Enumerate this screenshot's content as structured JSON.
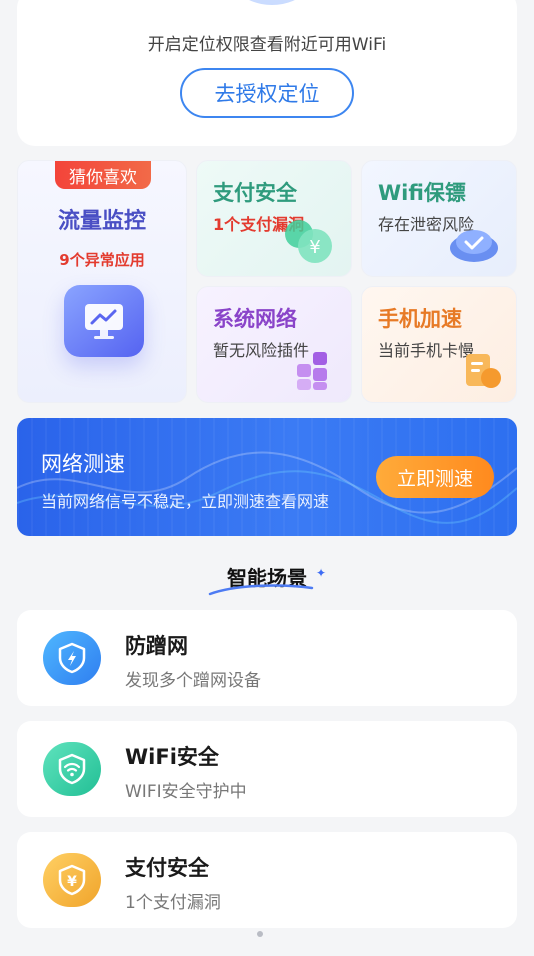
{
  "location_card": {
    "message": "开启定位权限查看附近可用WiFi",
    "button_label": "去授权定位"
  },
  "features": {
    "featured": {
      "badge": "猜你喜欢",
      "title": "流量监控",
      "subtitle": "9个异常应用"
    },
    "tiles": [
      {
        "title": "支付安全",
        "subtitle": "1个支付漏洞"
      },
      {
        "title": "Wifi保镖",
        "subtitle": "存在泄密风险"
      },
      {
        "title": "系统网络",
        "subtitle": "暂无风险插件"
      },
      {
        "title": "手机加速",
        "subtitle": "当前手机卡慢"
      }
    ]
  },
  "speed_banner": {
    "title": "网络测速",
    "subtitle": "当前网络信号不稳定，立即测速查看网速",
    "button_label": "立即测速"
  },
  "smart_scenes": {
    "heading": "智能场景",
    "items": [
      {
        "title": "防蹭网",
        "subtitle": "发现多个蹭网设备",
        "icon": "shield-lightning-icon",
        "color": "#2f8ef0"
      },
      {
        "title": "WiFi安全",
        "subtitle": "WIFI安全守护中",
        "icon": "shield-wifi-icon",
        "color": "#2fc6a0"
      },
      {
        "title": "支付安全",
        "subtitle": "1个支付漏洞",
        "icon": "shield-yen-icon",
        "color": "#f2b436"
      }
    ]
  },
  "colors": {
    "primary_blue": "#3d86f0",
    "alert_red": "#e33b2f",
    "orange": "#ff8a1e"
  }
}
